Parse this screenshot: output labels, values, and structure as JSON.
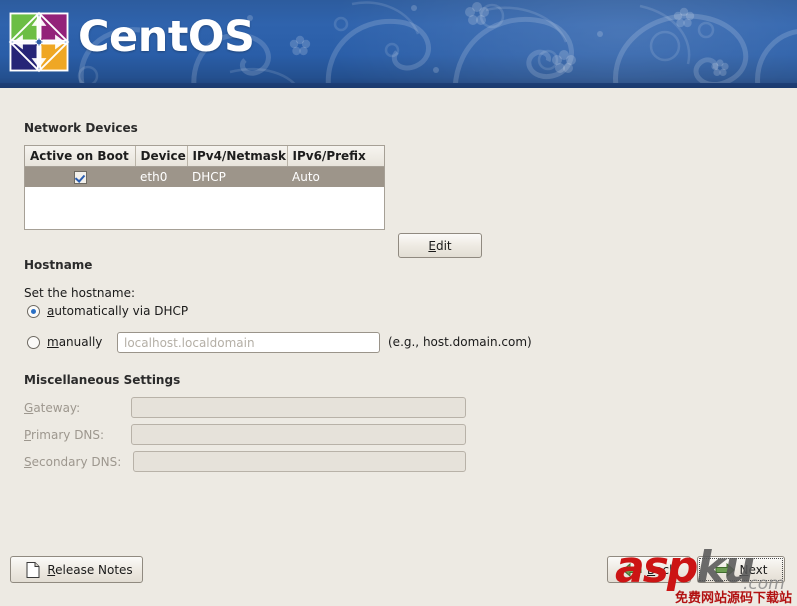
{
  "header": {
    "product_name": "CentOS",
    "logo_icon": "centos-logo-icon",
    "logo_colors": [
      "#6cbe45",
      "#932279",
      "#efa724",
      "#262577"
    ],
    "banner_color": "#2a5ea8"
  },
  "network_section": {
    "title": "Network Devices",
    "columns": [
      "Active on Boot",
      "Device",
      "IPv4/Netmask",
      "IPv6/Prefix"
    ],
    "rows": [
      {
        "active_on_boot": true,
        "device": "eth0",
        "ipv4_netmask": "DHCP",
        "ipv6_prefix": "Auto",
        "selected": true
      }
    ],
    "edit_button": {
      "label": "Edit",
      "accelerator": "E"
    },
    "selected_row_color": "#9d958a"
  },
  "hostname_section": {
    "title": "Hostname",
    "prompt": "Set the hostname:",
    "options": [
      {
        "label": "automatically via DHCP",
        "accelerator": "a",
        "selected": true
      },
      {
        "label": "manually",
        "accelerator": "m",
        "selected": false
      }
    ],
    "manual_input": {
      "value": "",
      "placeholder": "localhost.localdomain",
      "enabled": false
    },
    "hint": "(e.g., host.domain.com)"
  },
  "misc_section": {
    "title": "Miscellaneous Settings",
    "fields": [
      {
        "label": "Gateway:",
        "accelerator": "G",
        "value": "",
        "enabled": false
      },
      {
        "label": "Primary DNS:",
        "accelerator": "P",
        "value": "",
        "enabled": false
      },
      {
        "label": "Secondary DNS:",
        "accelerator": "S",
        "value": "",
        "enabled": false
      }
    ]
  },
  "footer": {
    "release_notes": {
      "label": "Release Notes",
      "accelerator": "R",
      "icon": "document-icon"
    },
    "back": {
      "label": "Back",
      "accelerator": "B",
      "icon": "arrow-left-icon"
    },
    "next": {
      "label": "Next",
      "accelerator": "N",
      "icon": "arrow-right-icon",
      "focused": true
    }
  },
  "watermark": {
    "text_red": "asp",
    "text_gray": "ku",
    "text_domain": ".com",
    "text_chinese": "免费网站源码下载站",
    "color_red": "#cc1414",
    "color_gray": "#585858"
  }
}
